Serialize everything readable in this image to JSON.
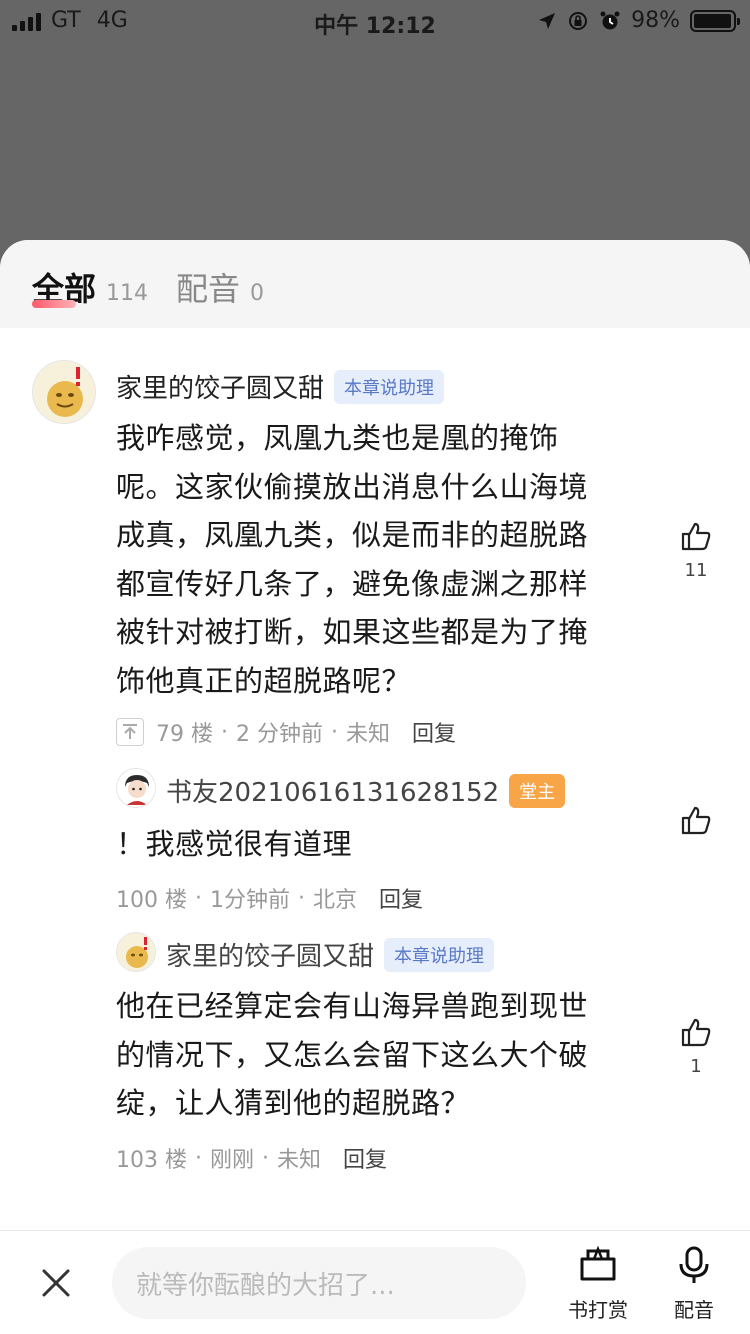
{
  "status_bar": {
    "carrier": "GT",
    "network": "4G",
    "time": "中午 12:12",
    "battery": "98%",
    "battery_level": 0.98
  },
  "tabs": [
    {
      "label": "全部",
      "count": "114",
      "active": true
    },
    {
      "label": "配音",
      "count": "0",
      "active": false
    }
  ],
  "comments": [
    {
      "author": "家里的饺子圆又甜",
      "badge": "本章说助理",
      "text_lines": [
        "我咋感觉，凤凰九类也是凰的掩饰",
        "呢。这家伙偷摸放出消息什么山海境",
        "成真，凤凰九类，似是而非的超脱路",
        "都宣传好几条了，避免像虚渊之那样",
        "被针对被打断，如果这些都是为了掩",
        "饰他真正的超脱路呢？"
      ],
      "floor": "79 楼",
      "time": "2 分钟前",
      "location": "未知",
      "reply": "回复",
      "likes": "11"
    },
    {
      "author": "书友20210616131628152",
      "badge": "堂主",
      "text": "！我感觉很有道理",
      "floor": "100 楼",
      "time": "1分钟前",
      "location": "北京",
      "reply": "回复",
      "likes": ""
    },
    {
      "author": "家里的饺子圆又甜",
      "badge": "本章说助理",
      "text_lines": [
        "他在已经算定会有山海异兽跑到现世",
        "的情况下，又怎么会留下这么大个破",
        "绽，让人猜到他的超脱路？"
      ],
      "floor": "103 楼",
      "time": "刚刚",
      "location": "未知",
      "reply": "回复",
      "likes": "1"
    }
  ],
  "meta_separator": "·",
  "bottom_bar": {
    "input_placeholder": "就等你酝酿的大招了...",
    "gift_label": "书打赏",
    "dub_label": "配音"
  },
  "icons": [
    "signal-icon",
    "location-arrow-icon",
    "rotation-lock-icon",
    "alarm-icon",
    "battery-icon",
    "thumbs-up-icon",
    "pin-top-icon",
    "close-icon",
    "gift-icon",
    "microphone-icon"
  ]
}
